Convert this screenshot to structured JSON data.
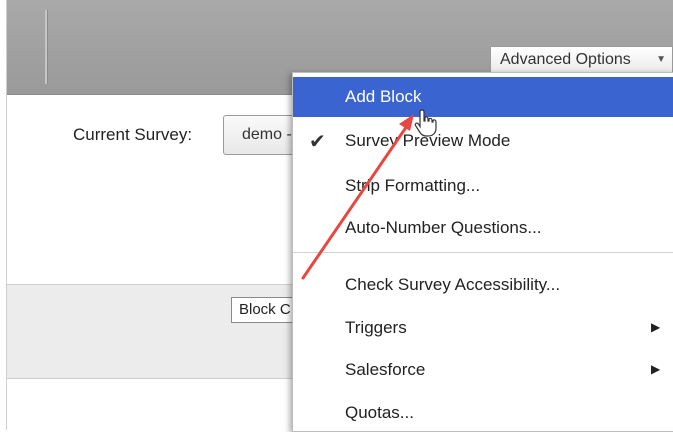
{
  "toolbar": {
    "advanced_options_label": "Advanced Options"
  },
  "survey": {
    "current_label": "Current Survey:",
    "selected_survey": "demo -"
  },
  "block": {
    "button_label": "Block C"
  },
  "menu": {
    "items": [
      {
        "label": "Add Block",
        "highlighted": true
      },
      {
        "label": "Survey Preview Mode",
        "checked": true
      },
      {
        "label": "Strip Formatting..."
      },
      {
        "label": "Auto-Number Questions..."
      },
      {
        "label": "Check Survey Accessibility..."
      },
      {
        "label": "Triggers",
        "has_submenu": true
      },
      {
        "label": "Salesforce",
        "has_submenu": true
      },
      {
        "label": "Quotas..."
      }
    ]
  },
  "colors": {
    "highlight": "#3a64cf",
    "annotation_arrow": "#e8473f",
    "toolbar_bg": "#a3a3a3"
  },
  "icons": {
    "check": "checkmark-icon",
    "submenu": "submenu-arrow-icon",
    "dropdown": "chevron-down-icon",
    "cursor": "hand-cursor-icon"
  }
}
